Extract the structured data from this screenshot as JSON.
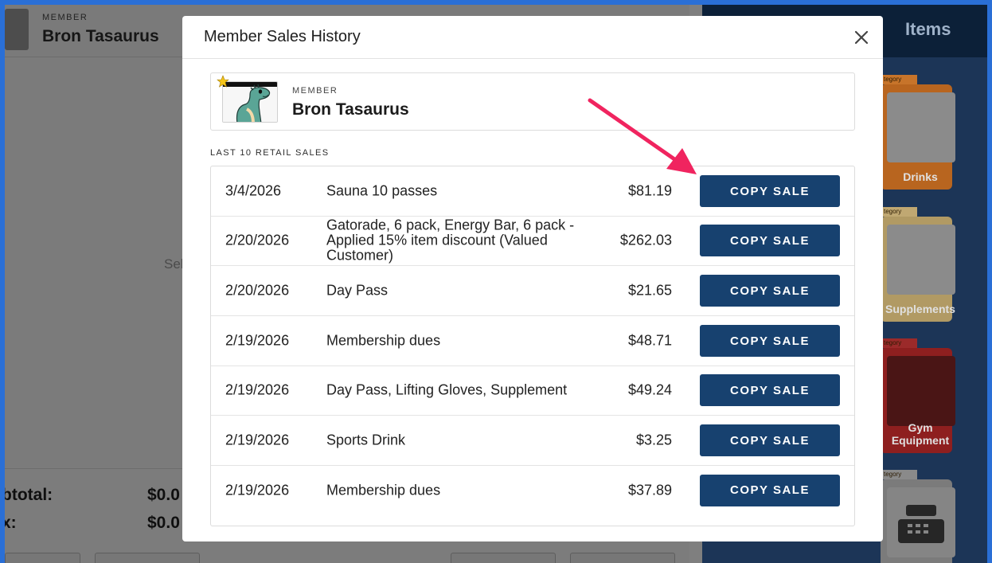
{
  "background": {
    "member_label": "MEMBER",
    "member_name": "Bron Tasaurus",
    "empty_message": "Sel",
    "subtotal_label": "btotal:",
    "subtotal_value": "$0.0",
    "tax_label": "x:",
    "tax_value": "$0.0",
    "items_title": "Items",
    "categories": [
      {
        "tag": "tegory",
        "name": "Drinks",
        "color": "#b8651f"
      },
      {
        "tag": "tegory",
        "name": "Supplements",
        "color": "#b19a64"
      },
      {
        "tag": "tegory",
        "name": "Gym Equipment",
        "color": "#8e1f1f"
      },
      {
        "tag": "tegory",
        "name": "",
        "color": "#7b7b7b"
      }
    ]
  },
  "modal": {
    "title": "Member Sales History",
    "close_icon": "close-icon",
    "member": {
      "label": "MEMBER",
      "name": "Bron Tasaurus",
      "favorite_icon": "star-icon"
    },
    "section_title": "LAST 10 RETAIL SALES",
    "copy_label": "COPY SALE",
    "sales": [
      {
        "date": "3/4/2026",
        "description": "Sauna 10 passes",
        "amount": "$81.19"
      },
      {
        "date": "2/20/2026",
        "description": "Gatorade, 6 pack, Energy Bar, 6 pack - Applied 15% item discount (Valued Customer)",
        "amount": "$262.03"
      },
      {
        "date": "2/20/2026",
        "description": "Day Pass",
        "amount": "$21.65"
      },
      {
        "date": "2/19/2026",
        "description": "Membership dues",
        "amount": "$48.71"
      },
      {
        "date": "2/19/2026",
        "description": "Day Pass, Lifting Gloves, Supplement",
        "amount": "$49.24"
      },
      {
        "date": "2/19/2026",
        "description": "Sports Drink",
        "amount": "$3.25"
      },
      {
        "date": "2/19/2026",
        "description": "Membership dues",
        "amount": "$37.89"
      }
    ]
  },
  "colors": {
    "primary_button": "#17416f",
    "annotation_arrow": "#f0245f",
    "star": "#f5c518"
  }
}
